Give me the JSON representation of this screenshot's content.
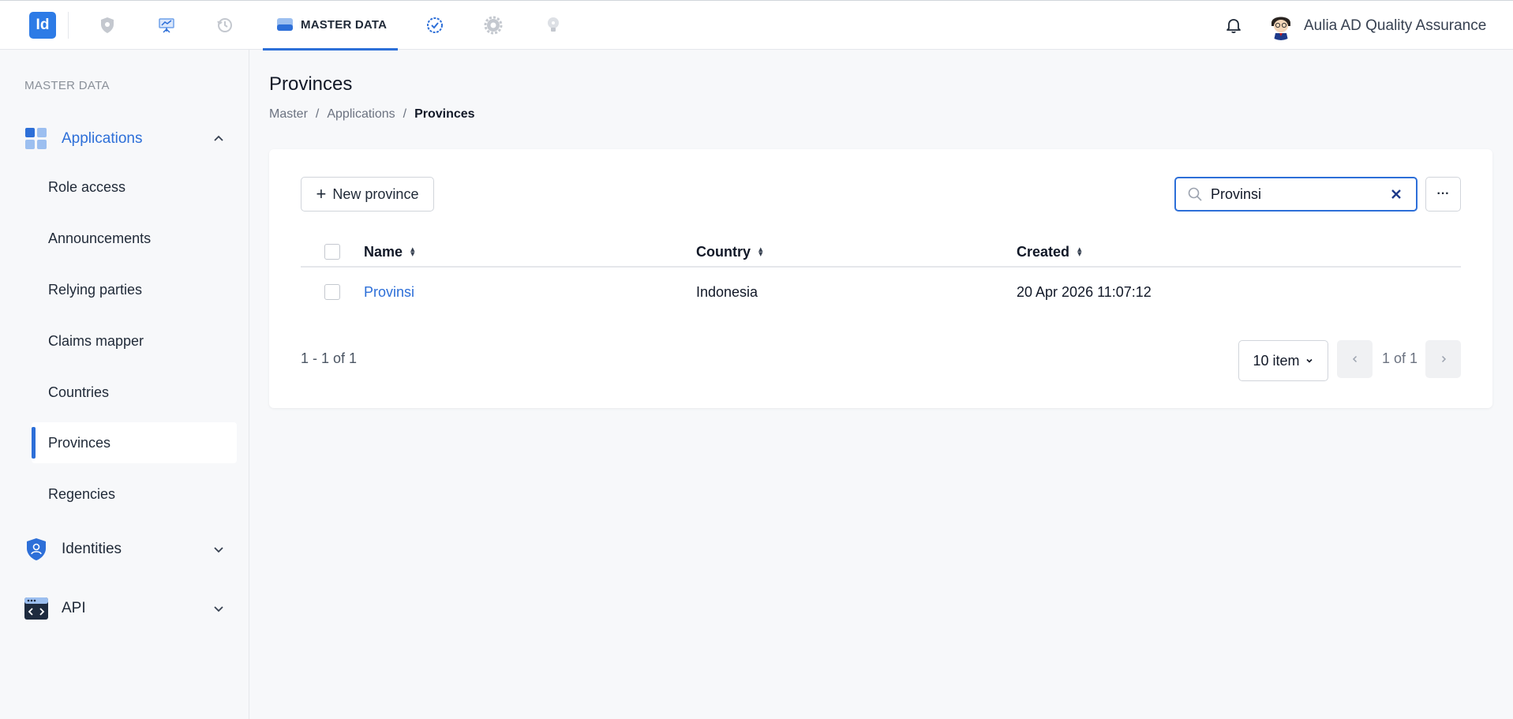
{
  "topbar": {
    "logo": "Id",
    "nav_icons": [
      "shield-icon",
      "presentation-icon",
      "history-icon",
      "master-data-icon",
      "verified-icon",
      "gear-icon",
      "lightbulb-icon"
    ],
    "active_tab": "MASTER DATA",
    "user_name": "Aulia AD Quality Assurance",
    "accent": "#2d6fd8"
  },
  "sidebar": {
    "section_title": "MASTER DATA",
    "groups": [
      {
        "label": "Applications",
        "icon": "applications-grid-icon",
        "expanded": true
      },
      {
        "label": "Identities",
        "icon": "identity-shield-icon",
        "expanded": false
      },
      {
        "label": "API",
        "icon": "api-code-icon",
        "expanded": false
      }
    ],
    "items": [
      "Role access",
      "Announcements",
      "Relying parties",
      "Claims mapper",
      "Countries",
      "Provinces",
      "Regencies"
    ],
    "active_item": "Provinces"
  },
  "main": {
    "title": "Provinces",
    "breadcrumb": [
      "Master",
      "Applications",
      "Provinces"
    ],
    "new_button": "New province",
    "search_value": "Provinsi",
    "more_label": "···",
    "columns": [
      "Name",
      "Country",
      "Created"
    ],
    "rows": [
      {
        "name": "Provinsi",
        "country": "Indonesia",
        "created": "20 Apr 2026 11:07:12"
      }
    ],
    "count_text": "1 - 1 of 1",
    "page_size": "10 item",
    "page_info": "1 of 1"
  }
}
